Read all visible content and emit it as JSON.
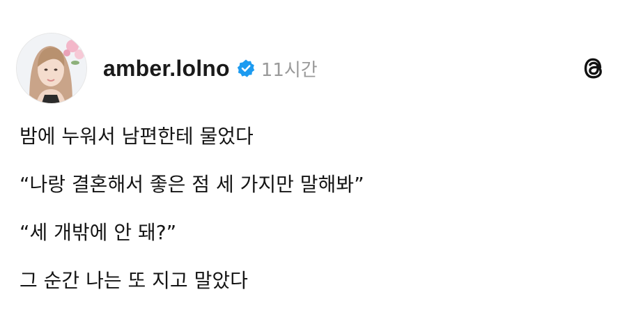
{
  "post": {
    "author": {
      "username": "amber.lolno",
      "verified": true,
      "avatar_icon": "profile-photo"
    },
    "timestamp": "11시간",
    "app_icon": "threads-icon",
    "lines": [
      "밤에 누워서 남편한테 물었다",
      "“나랑 결혼해서 좋은 점 세 가지만 말해봐”",
      "“세 개밖에 안 돼?”",
      "그 순간 나는 또 지고 말았다"
    ]
  },
  "colors": {
    "verified_badge": "#1d9bf0",
    "timestamp": "#9a9a9a",
    "text": "#141414"
  }
}
